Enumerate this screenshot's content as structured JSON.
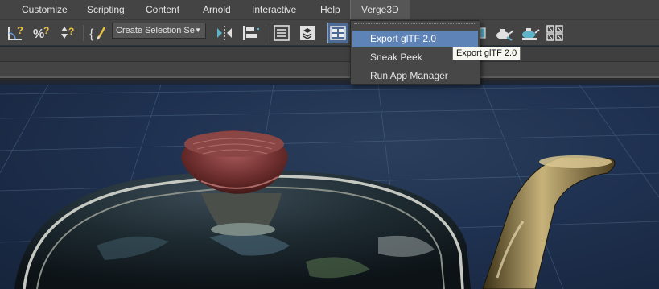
{
  "menubar": {
    "items": [
      "Customize",
      "Scripting",
      "Content",
      "Arnold",
      "Interactive",
      "Help",
      "Verge3D"
    ]
  },
  "toolbar": {
    "selection_set": {
      "value": "Create Selection Se",
      "arrow": "▼"
    },
    "icons": [
      "angle-snap-icon",
      "percent-snap-icon",
      "spinner-snap-icon",
      "edit-named-selection-icon",
      "mirror-icon",
      "align-icon",
      "scene-explorer-icon",
      "layer-explorer-icon",
      "ribbon-toggle-icon",
      "render-setup-icon",
      "render-frame-icon",
      "render-production-icon"
    ]
  },
  "dropdown": {
    "items": [
      "Export glTF 2.0",
      "Sneak Peek",
      "Run App Manager"
    ],
    "highlighted_index": 0
  },
  "tooltip": {
    "text": "Export glTF 2.0"
  },
  "colors": {
    "ui_bg": "#444444",
    "highlight": "#5e83b6",
    "viewport_bg": "#1f3150",
    "teapot_lid_knob": "#7a3a36"
  }
}
